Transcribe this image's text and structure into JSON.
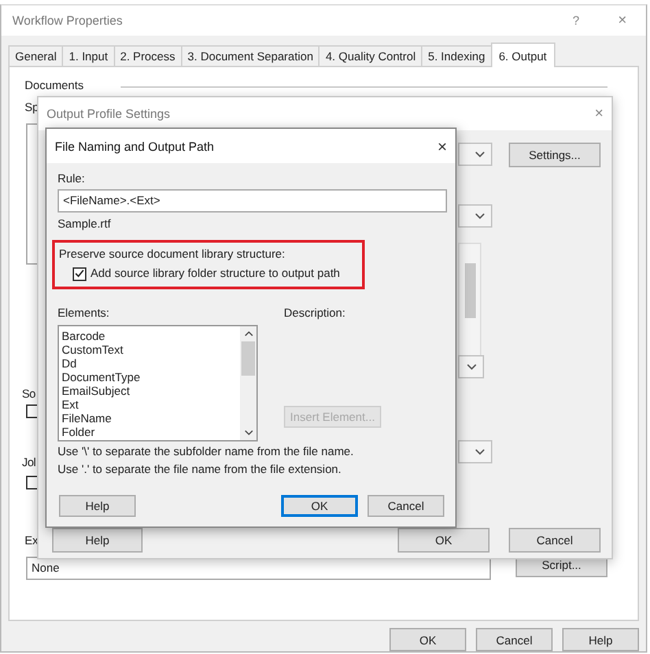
{
  "main_window": {
    "title": "Workflow Properties",
    "help_glyph": "?",
    "close_glyph": "×",
    "tabs": [
      {
        "label": "General",
        "selected": false
      },
      {
        "label": "1. Input",
        "selected": false
      },
      {
        "label": "2. Process",
        "selected": false
      },
      {
        "label": "3. Document Separation",
        "selected": false
      },
      {
        "label": "4. Quality Control",
        "selected": false
      },
      {
        "label": "5. Indexing",
        "selected": false
      },
      {
        "label": "6. Output",
        "selected": true
      }
    ],
    "section_title": "Documents",
    "partial_label": "Sp",
    "option_rows": [
      {
        "label": "So",
        "checked": false
      },
      {
        "label": "Jol",
        "checked": false
      }
    ],
    "expression_label": "Ex",
    "expression_value": "None",
    "script_button": "Script...",
    "buttons": [
      "OK",
      "Cancel",
      "Help"
    ]
  },
  "profile_dialog": {
    "title": "Output Profile Settings",
    "close_glyph": "×",
    "settings_button": "Settings...",
    "buttons": [
      "Help",
      "OK",
      "Cancel"
    ]
  },
  "naming_dialog": {
    "title": "File Naming and Output Path",
    "close_glyph": "×",
    "rule_label": "Rule:",
    "rule_value": "<FileName>.<Ext>",
    "sample": "Sample.rtf",
    "preserve": {
      "heading": "Preserve source document library structure:",
      "highlighted": true,
      "option": {
        "label": "Add source library folder structure to output path",
        "checked": true
      }
    },
    "elements_label": "Elements:",
    "elements": [
      "Barcode",
      "CustomText",
      "Dd",
      "DocumentType",
      "EmailSubject",
      "Ext",
      "FileName",
      "Folder"
    ],
    "description_label": "Description:",
    "insert_button": {
      "label": "Insert Element...",
      "disabled": true
    },
    "notes": [
      "Use '\\' to separate the subfolder name from the file name.",
      "Use '.' to separate the file name from the file extension."
    ],
    "buttons": [
      {
        "label": "Help",
        "default": false
      },
      {
        "label": "OK",
        "default": true
      },
      {
        "label": "Cancel",
        "default": false
      }
    ]
  }
}
